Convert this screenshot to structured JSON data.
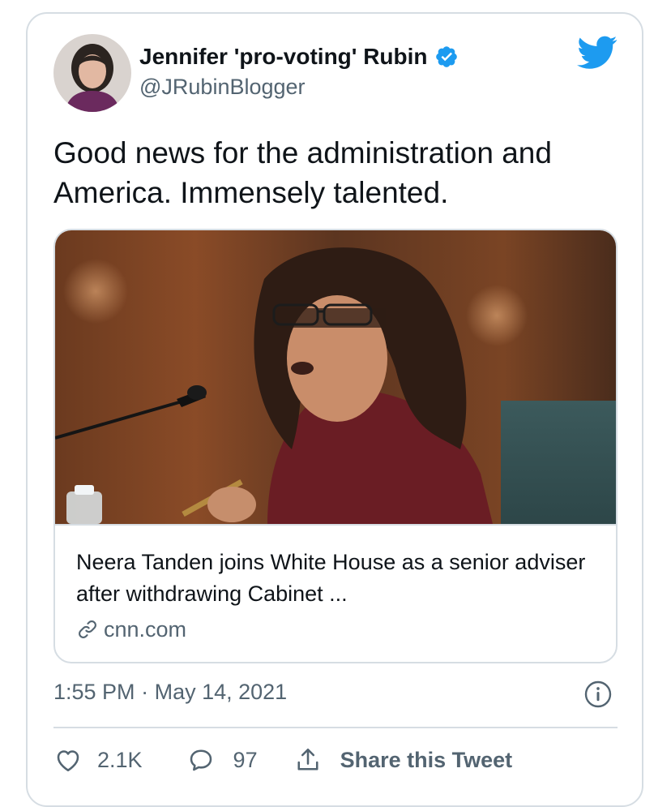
{
  "author": {
    "name": "Jennifer 'pro-voting' Rubin",
    "handle": "@JRubinBlogger",
    "verified": true
  },
  "tweet": {
    "text": "Good news for the administration and America. Immensely talented."
  },
  "link_card": {
    "title": "Neera Tanden joins White House as a senior adviser after withdrawing Cabinet ...",
    "domain": "cnn.com",
    "link_icon": "link-icon"
  },
  "meta": {
    "time": "1:55 PM",
    "separator": "·",
    "date": "May 14, 2021"
  },
  "actions": {
    "like_count": "2.1K",
    "reply_count": "97",
    "share_label": "Share this Tweet"
  },
  "colors": {
    "accent": "#1d9bf0",
    "text": "#0f1419",
    "muted": "#536471",
    "border": "#d6dde3"
  }
}
